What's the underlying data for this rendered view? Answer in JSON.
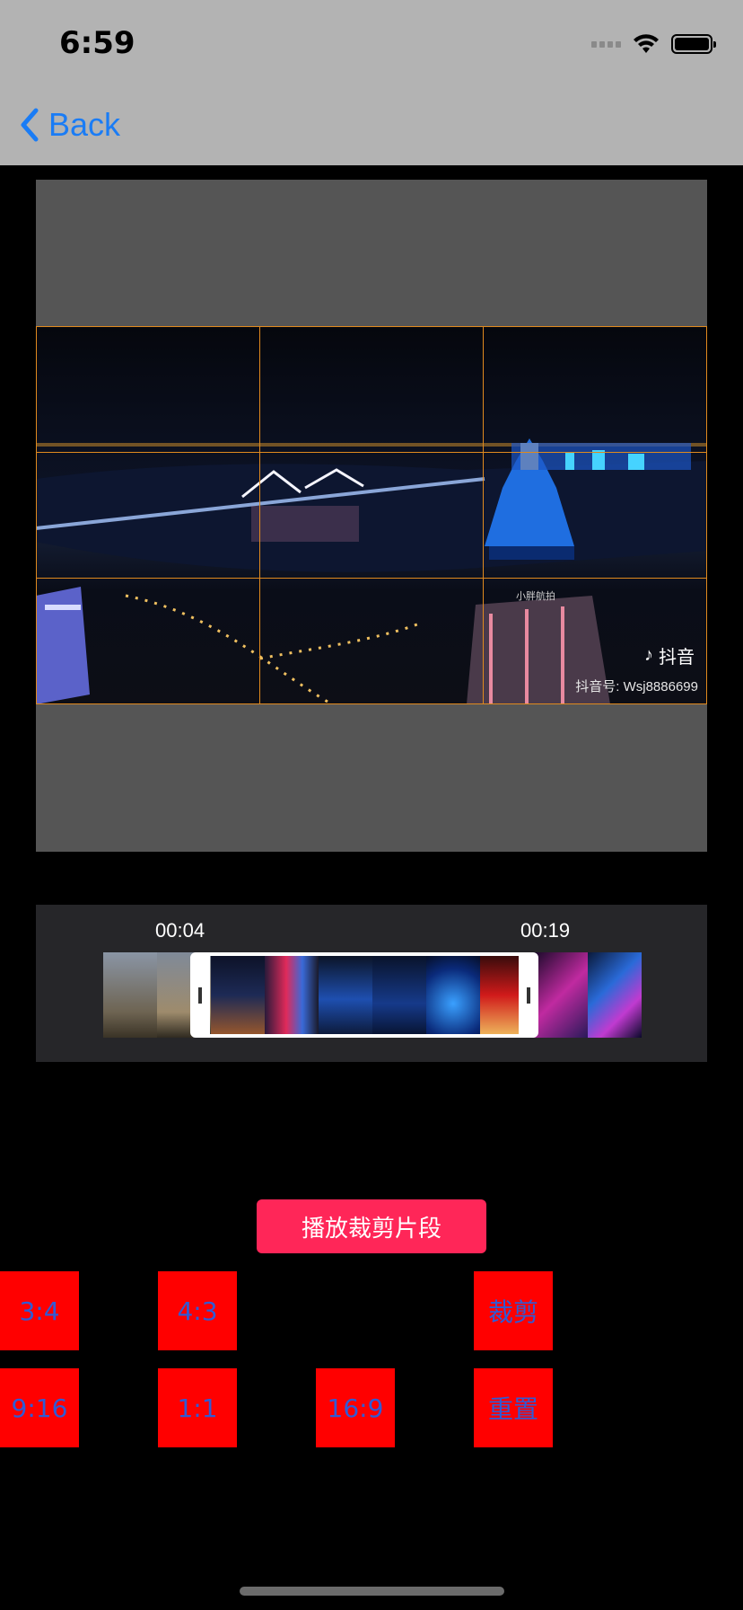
{
  "status_bar": {
    "time": "6:59"
  },
  "nav": {
    "back_label": "Back"
  },
  "video": {
    "watermark_brand": "抖音",
    "watermark_id": "抖音号: Wsj8886699",
    "small_caption": "小胖航拍"
  },
  "timeline": {
    "start_time": "00:04",
    "end_time": "00:19"
  },
  "actions": {
    "play_clip": "播放裁剪片段",
    "btn_3_4": "3:4",
    "btn_4_3": "4:3",
    "btn_crop": "裁剪",
    "btn_9_16": "9:16",
    "btn_1_1": "1:1",
    "btn_16_9": "16:9",
    "btn_reset": "重置"
  },
  "colors": {
    "accent": "#ff2658",
    "button_bg": "#ff0000",
    "button_text": "#2f5bd6",
    "grid": "#e08a1e",
    "link": "#1a7cf5"
  }
}
